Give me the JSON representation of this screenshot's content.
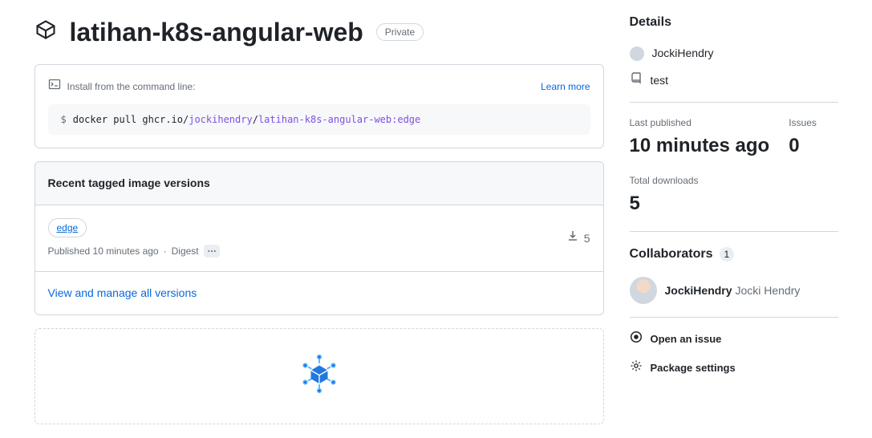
{
  "header": {
    "title": "latihan-k8s-angular-web",
    "visibility": "Private"
  },
  "install": {
    "label": "Install from the command line:",
    "learn_more": "Learn more",
    "prompt": "$",
    "cmd_prefix": "docker pull ghcr.io/",
    "cmd_user": "jockihendry",
    "cmd_sep": "/",
    "cmd_pkg": "latihan-k8s-angular-web:edge"
  },
  "versions": {
    "heading": "Recent tagged image versions",
    "items": [
      {
        "tag": "edge",
        "published_prefix": "Published ",
        "published_rel": "10 minutes ago",
        "digest_dot": "· ",
        "digest_label": "Digest",
        "downloads": "5"
      }
    ],
    "manage_link": "View and manage all versions"
  },
  "details": {
    "heading": "Details",
    "owner": "JockiHendry",
    "repo": "test",
    "stats": {
      "last_published_label": "Last published",
      "last_published_value": "10 minutes ago",
      "issues_label": "Issues",
      "issues_value": "0",
      "downloads_label": "Total downloads",
      "downloads_value": "5"
    },
    "collaborators_heading": "Collaborators",
    "collaborators_count": "1",
    "collaborators": [
      {
        "login": "JockiHendry",
        "name": "Jocki Hendry"
      }
    ],
    "open_issue": "Open an issue",
    "settings": "Package settings"
  }
}
